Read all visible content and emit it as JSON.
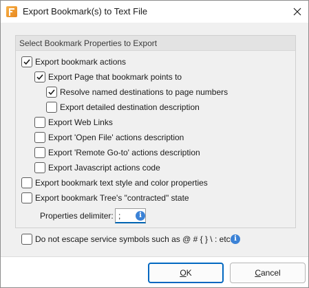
{
  "window": {
    "title": "Export Bookmark(s) to Text File"
  },
  "group": {
    "title": "Select Bookmark Properties to Export"
  },
  "options": {
    "export_actions": {
      "label": "Export bookmark actions",
      "checked": true
    },
    "export_page": {
      "label": "Export Page that bookmark points to",
      "checked": true
    },
    "resolve_named": {
      "label": "Resolve named destinations to page numbers",
      "checked": true
    },
    "export_detailed": {
      "label": "Export detailed destination description",
      "checked": false
    },
    "export_web_links": {
      "label": "Export Web Links",
      "checked": false
    },
    "export_open_file": {
      "label": "Export 'Open File' actions description",
      "checked": false
    },
    "export_remote_goto": {
      "label": "Export 'Remote Go-to' actions description",
      "checked": false
    },
    "export_javascript": {
      "label": "Export Javascript actions code",
      "checked": false
    },
    "export_text_style": {
      "label": "Export bookmark text style and color properties",
      "checked": false
    },
    "export_contracted": {
      "label": "Export bookmark Tree's \"contracted\" state",
      "checked": false
    },
    "no_escape": {
      "label": "Do not escape service symbols such as @ # { } \\ : etc.",
      "checked": false
    }
  },
  "delimiter": {
    "label": "Properties delimiter:",
    "value": ";"
  },
  "buttons": {
    "ok": {
      "underline": "O",
      "rest": "K"
    },
    "cancel": {
      "underline": "C",
      "rest": "ancel"
    }
  },
  "colors": {
    "accent": "#0067c0",
    "info": "#3b82d6",
    "panel": "#f0f0f0"
  },
  "icons": {
    "app": "app-icon",
    "close": "close-icon",
    "check": "checkmark-icon",
    "info": "info-icon"
  }
}
